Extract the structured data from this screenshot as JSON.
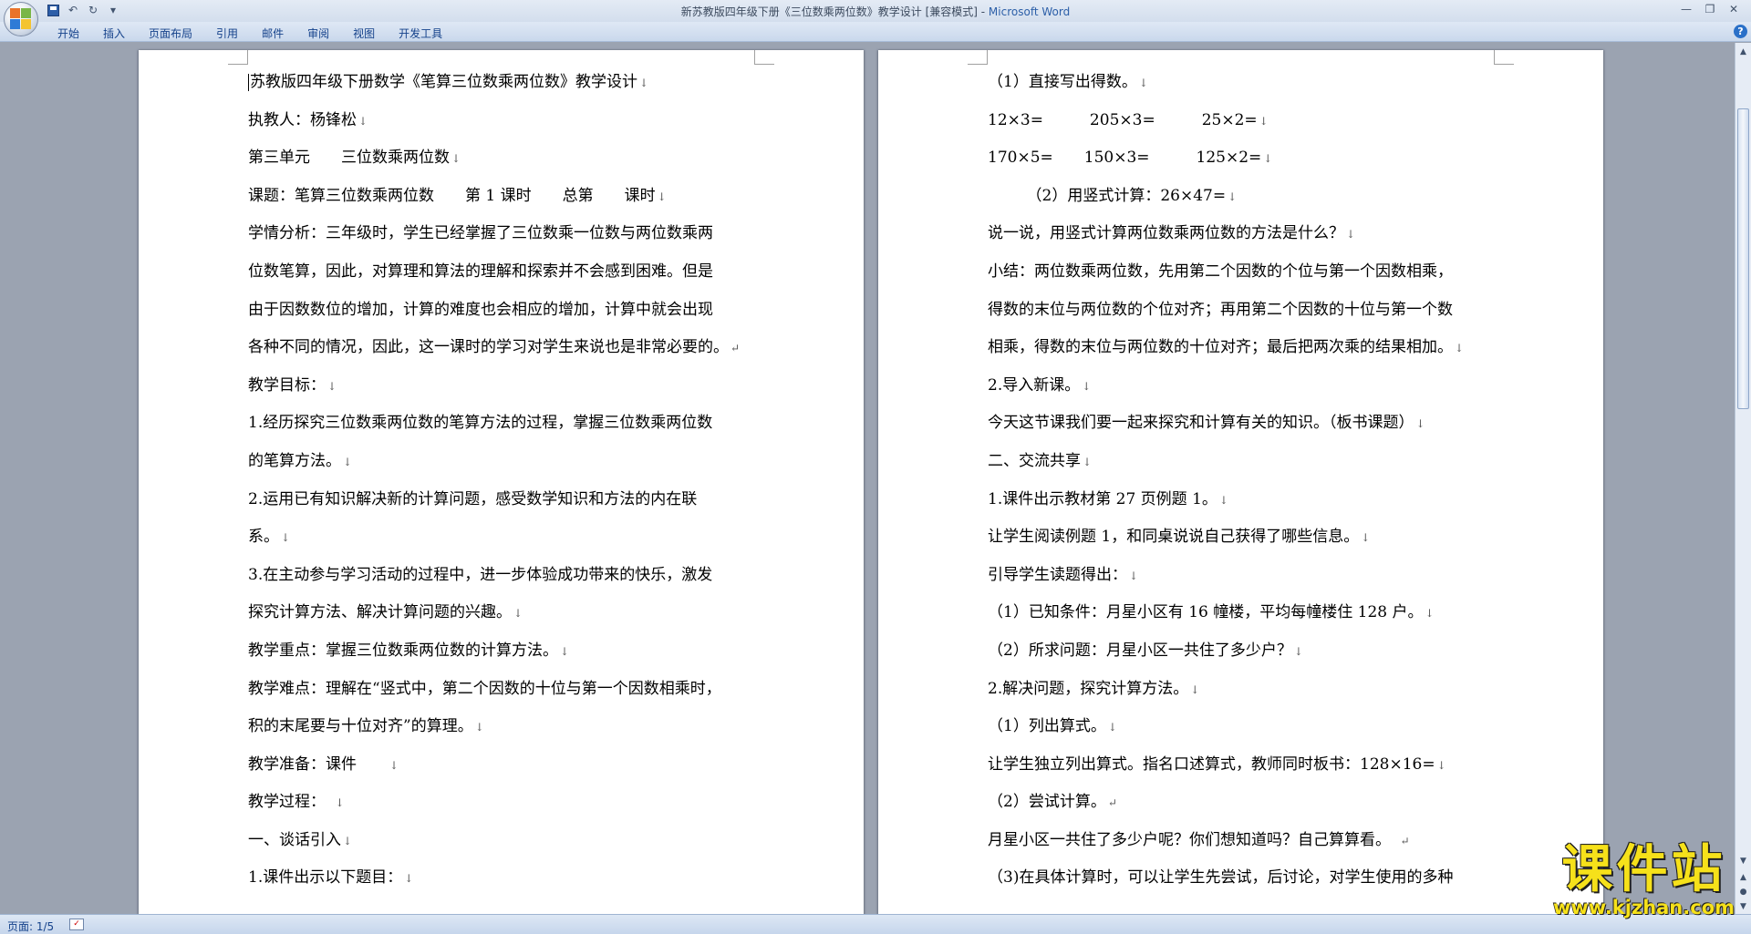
{
  "titlebar": {
    "document_title": "新苏教版四年级下册《三位数乘两位数》教学设计 [兼容模式] - ",
    "app_name": "Microsoft Word",
    "qat_save_icon": "save-icon",
    "qat_undo_icon": "↶",
    "qat_redo_icon": "↻",
    "qat_dropdown_icon": "▾",
    "minimize": "—",
    "maximize": "❐",
    "close": "✕"
  },
  "ribbon": {
    "tabs": [
      "开始",
      "插入",
      "页面布局",
      "引用",
      "邮件",
      "审阅",
      "视图",
      "开发工具"
    ],
    "help_icon": "?"
  },
  "pages": {
    "left": {
      "lines": [
        "苏教版四年级下册数学《笔算三位数乘两位数》教学设计",
        "执教人：杨锋松",
        "第三单元　　三位数乘两位数",
        "课题：笔算三位数乘两位数　　第 1 课时　　总第　　课时",
        "学情分析：三年级时，学生已经掌握了三位数乘一位数与两位数乘两",
        "位数笔算，因此，对算理和算法的理解和探索并不会感到困难。但是",
        "由于因数数位的增加，计算的难度也会相应的增加，计算中就会出现",
        "各种不同的情况，因此，这一课时的学习对学生来说也是非常必要的。",
        "教学目标：",
        "1.经历探究三位数乘两位数的笔算方法的过程，掌握三位数乘两位数",
        "的笔算方法。",
        "2.运用已有知识解决新的计算问题，感受数学知识和方法的内在联",
        "系。",
        "3.在主动参与学习活动的过程中，进一步体验成功带来的快乐，激发",
        "探究计算方法、解决计算问题的兴趣。",
        "教学重点：掌握三位数乘两位数的计算方法。",
        "教学难点：理解在“竖式中，第二个因数的十位与第一个因数相乘时，",
        "积的末尾要与十位对齐”的算理。",
        "教学准备：课件　　",
        "教学过程：　",
        "一、谈话引入",
        "1.课件出示以下题目："
      ],
      "marks": [
        "↓",
        "↓",
        "↓",
        "↓",
        "",
        "",
        "",
        "↵",
        "↓",
        "",
        "↓",
        "",
        "↓",
        "",
        "↓",
        "↓",
        "",
        "↓",
        "↓",
        "↓",
        "↓",
        "↓"
      ]
    },
    "right": {
      "lines": [
        "（1）直接写出得数。",
        "12×3=　　　205×3=　　　25×2=",
        "170×5=　　150×3=　　　125×2=",
        "　　　（2）用竖式计算：26×47=",
        "说一说，用竖式计算两位数乘两位数的方法是什么？",
        "小结：两位数乘两位数，先用第二个因数的个位与第一个因数相乘，",
        "得数的末位与两位数的个位对齐；再用第二个因数的十位与第一个数",
        "相乘，得数的末位与两位数的十位对齐；最后把两次乘的结果相加。",
        "2.导入新课。",
        "今天这节课我们要一起来探究和计算有关的知识。（板书课题）",
        "二、交流共享",
        "1.课件出示教材第 27 页例题 1。",
        "让学生阅读例题 1，和同桌说说自己获得了哪些信息。",
        "引导学生读题得出：",
        "（1）已知条件：月星小区有 16 幢楼，平均每幢楼住 128 户。",
        "（2）所求问题：月星小区一共住了多少户？",
        "2.解决问题，探究计算方法。",
        "（1）列出算式。",
        "让学生独立列出算式。指名口述算式，教师同时板书：128×16=",
        "（2）尝试计算。",
        "月星小区一共住了多少户呢？你们想知道吗？自己算算看。　",
        "（3)在具体计算时，可以让学生先尝试，后讨论，对学生使用的多种"
      ],
      "marks": [
        "↓",
        "↓",
        "↓",
        "↓",
        "↓",
        "",
        "",
        "↓",
        "↓",
        "↓",
        "↓",
        "↓",
        "↓",
        "↓",
        "↓",
        "↓",
        "↓",
        "↓",
        "↓",
        "↵",
        "↵",
        ""
      ]
    }
  },
  "scrollbar": {
    "up": "▲",
    "down": "▼",
    "prev": "▲",
    "select": "●",
    "next": "▼"
  },
  "statusbar": {
    "page_label": "页面: 1/5",
    "spell_icon": "✓"
  },
  "watermark": {
    "main": "课件站",
    "url": "www.kjzhan.com"
  }
}
